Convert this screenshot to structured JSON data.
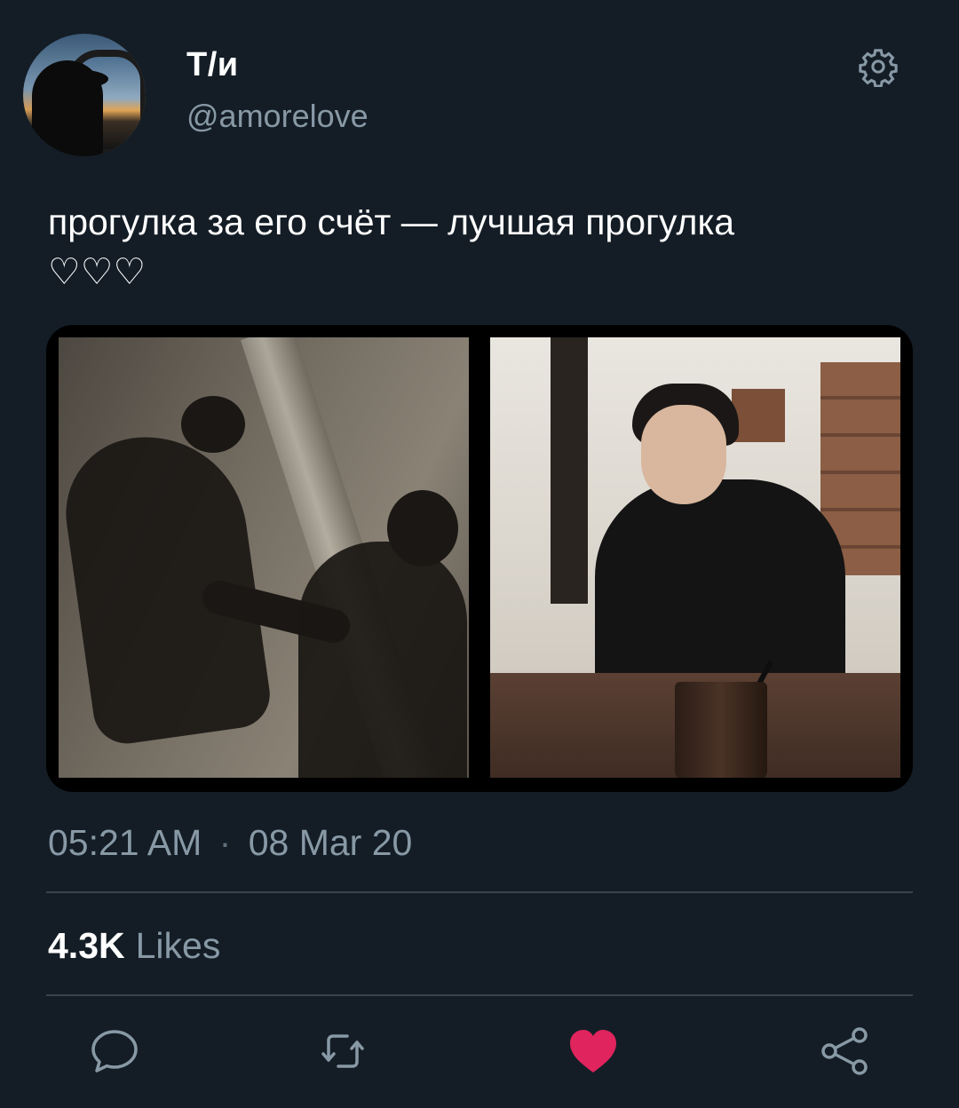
{
  "user": {
    "display_name": "Т/и",
    "handle": "@amorelove"
  },
  "tweet": {
    "text_line1": "прогулка за его счёт — лучшая прогулка",
    "text_line2": "♡♡♡",
    "time": "05:21 AM",
    "separator": "·",
    "date": "08 Mar 20",
    "likes_count": "4.3K",
    "likes_label": "Likes"
  },
  "icons": {
    "settings": "gear-icon",
    "reply": "reply-icon",
    "retweet": "retweet-icon",
    "like": "heart-icon",
    "share": "share-icon"
  },
  "colors": {
    "background": "#141d26",
    "secondary_text": "#8899a6",
    "divider": "#38444d",
    "like_active": "#e0245e"
  }
}
